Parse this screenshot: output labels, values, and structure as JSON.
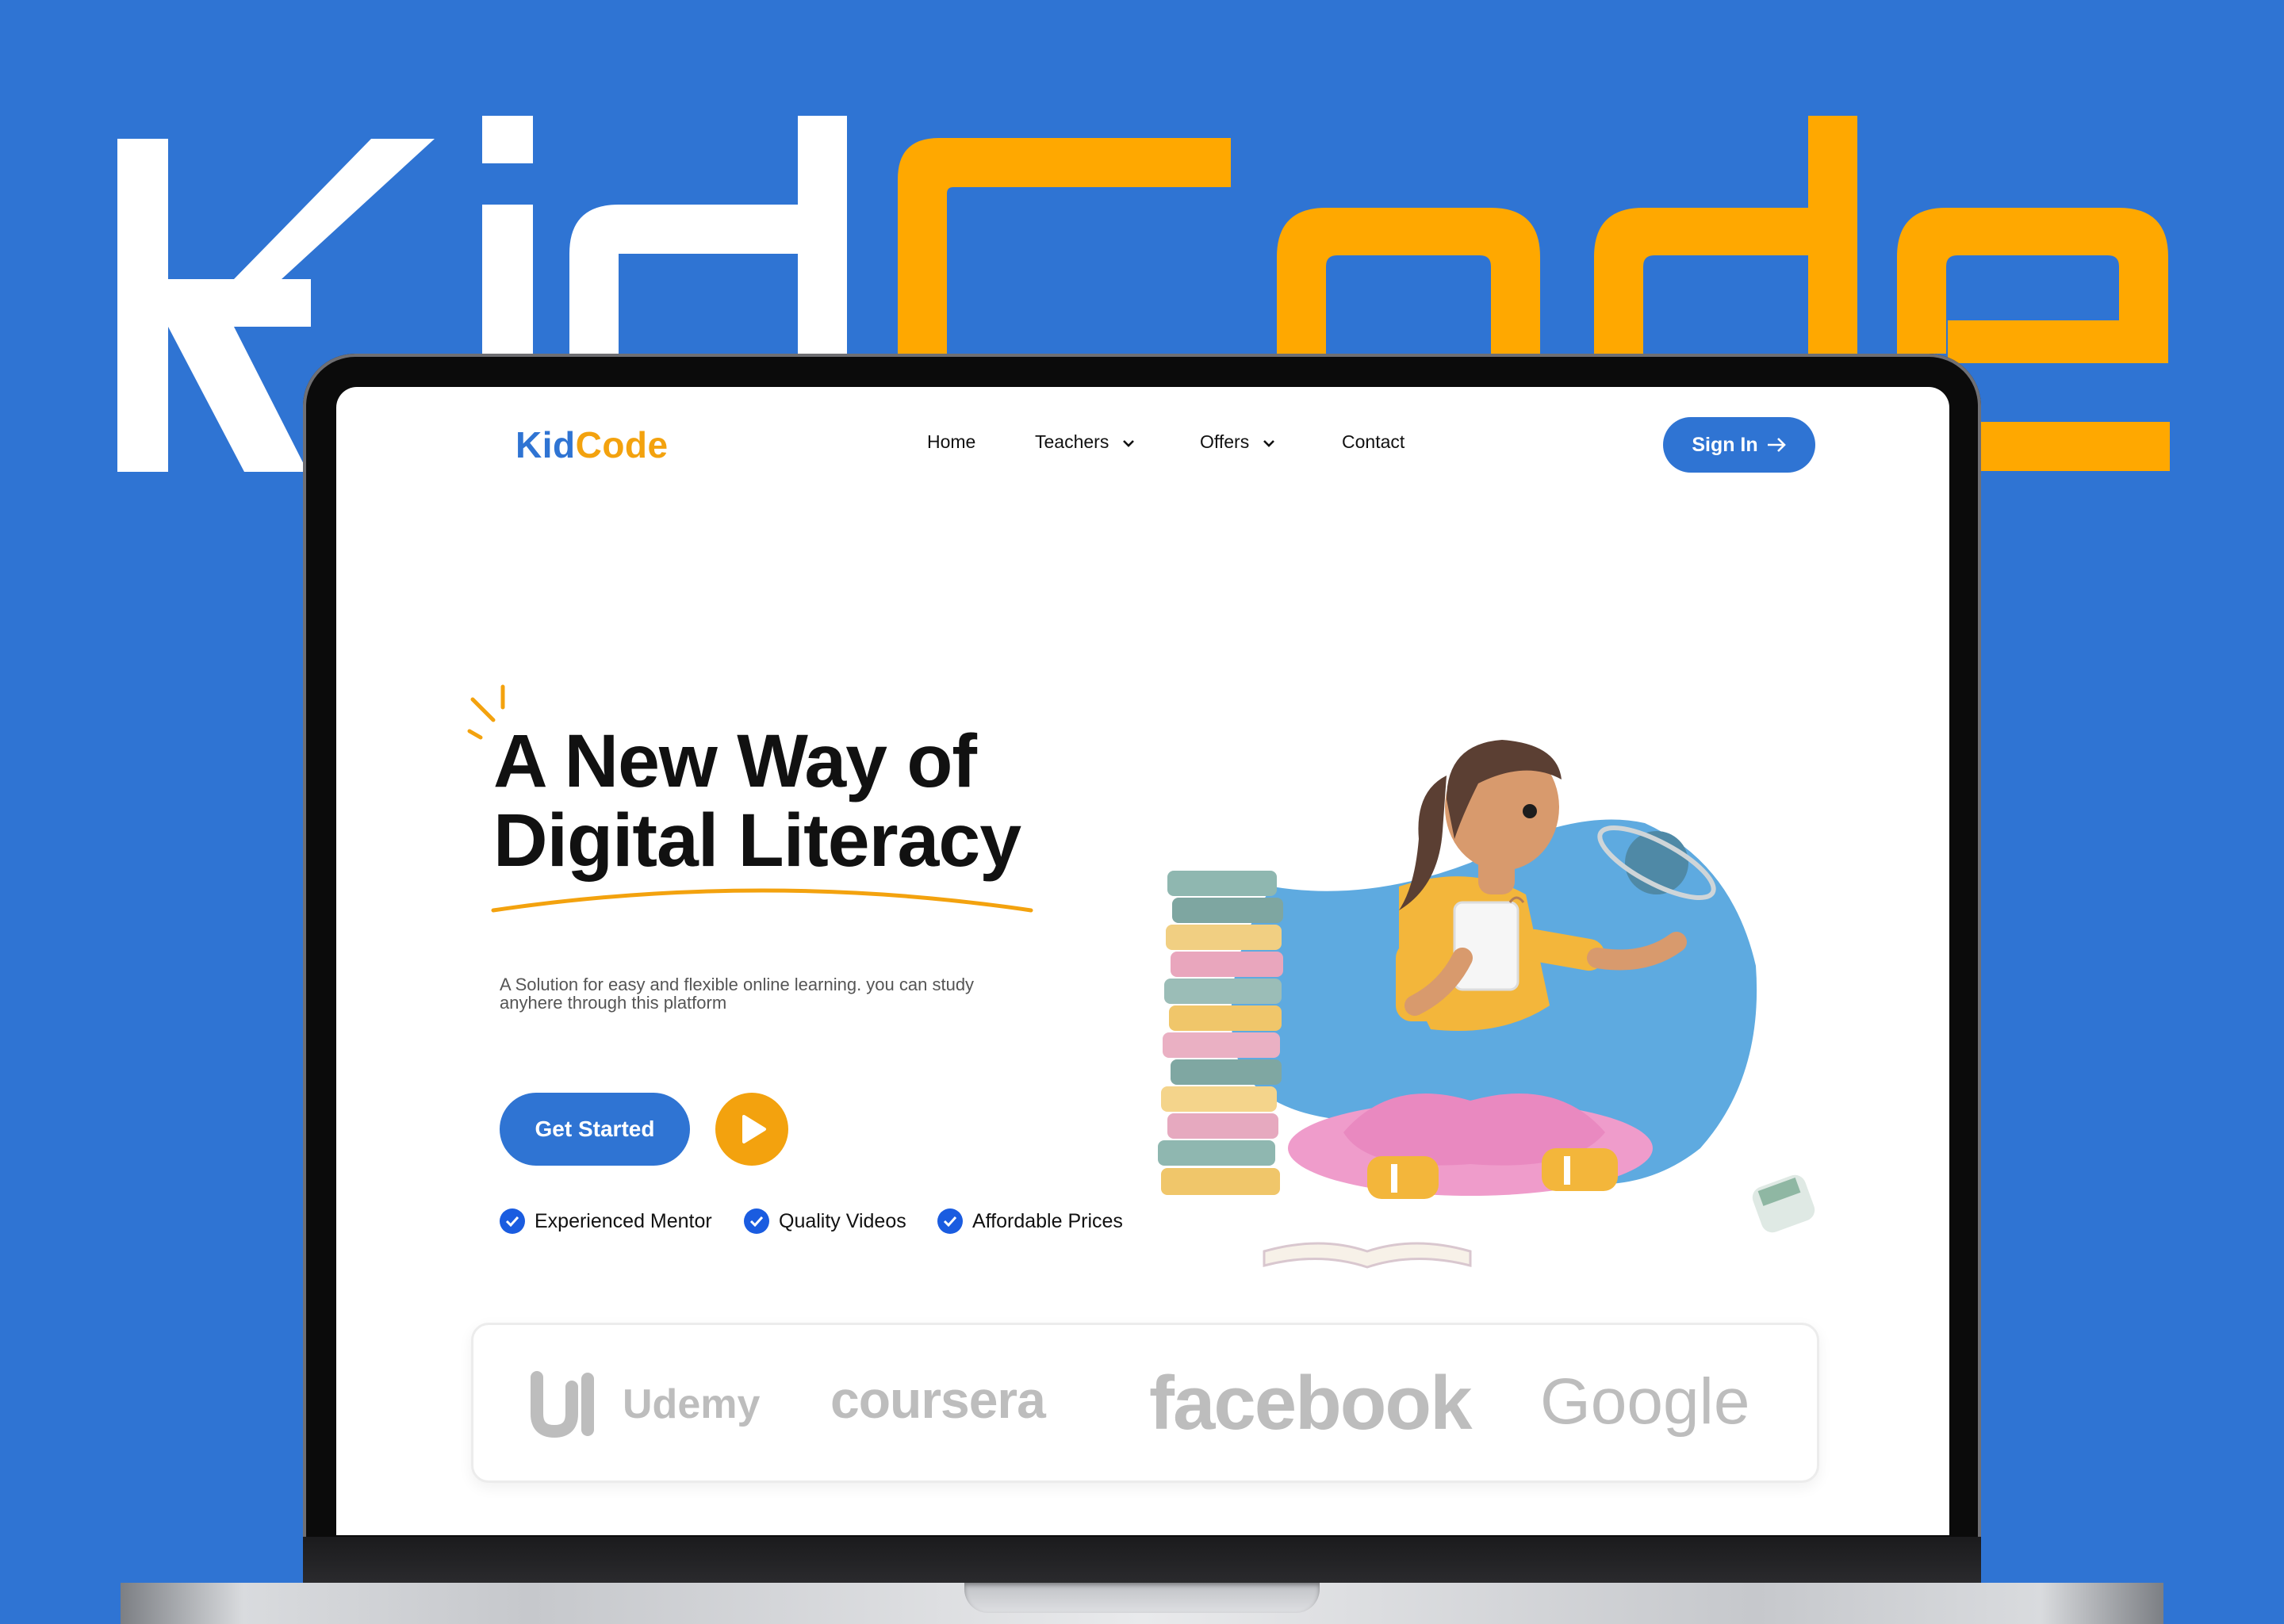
{
  "brand": {
    "first": "Kid",
    "second": "Code",
    "first_color": "#2f74d3",
    "second_color": "#f3a20e",
    "background_color": "#2f74d3",
    "big_word_colors": [
      "#ffffff",
      "#ffa800"
    ]
  },
  "nav": {
    "items": [
      {
        "label": "Home",
        "has_dropdown": false
      },
      {
        "label": "Teachers",
        "has_dropdown": true
      },
      {
        "label": "Offers",
        "has_dropdown": true
      },
      {
        "label": "Contact",
        "has_dropdown": false
      }
    ],
    "sign_in": "Sign In",
    "sign_in_icon": "arrow-right-icon"
  },
  "hero": {
    "title_line1": "A New Way of",
    "title_line2": "Digital Literacy",
    "subtitle_line1": "A Solution for easy and flexible online learning. you can study",
    "subtitle_line2": "anyhere through this platform",
    "cta": "Get Started",
    "play_icon": "play-icon",
    "features": [
      "Experienced Mentor",
      "Quality Videos",
      "Affordable Prices"
    ],
    "feature_icon": "check-circle-icon",
    "illustration": "girl-with-tablet-and-books"
  },
  "partners": [
    "Udemy",
    "coursera",
    "facebook",
    "Google"
  ]
}
